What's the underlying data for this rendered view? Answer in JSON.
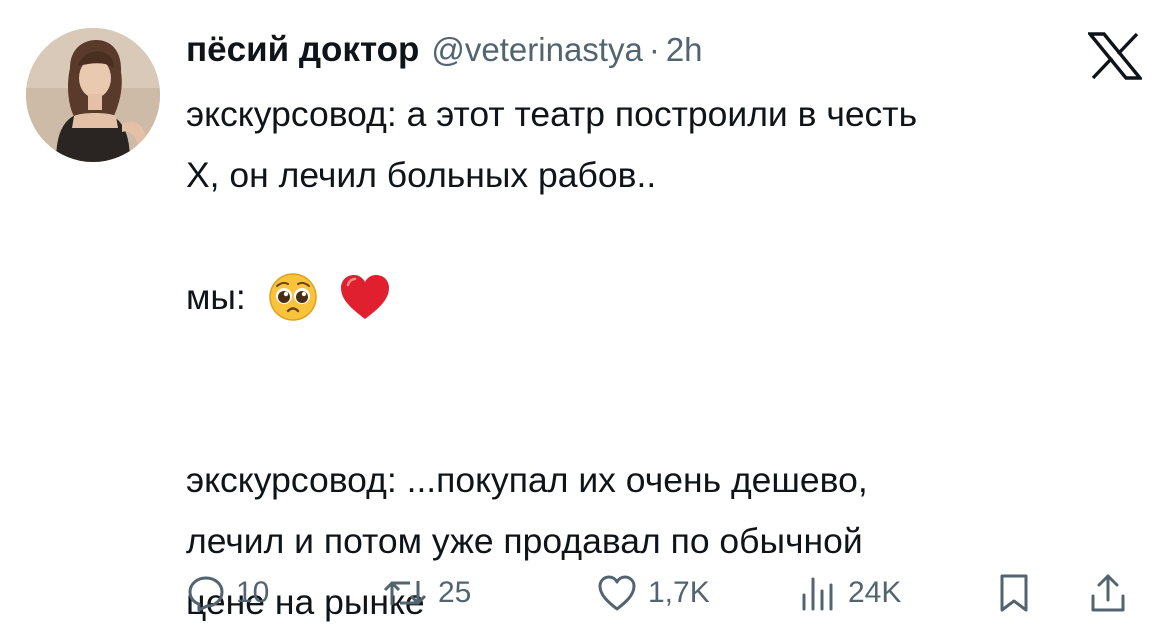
{
  "author": {
    "display_name": "пёсий доктор",
    "handle": "@veterinastya",
    "separator": "·",
    "time": "2h"
  },
  "platform_logo": "x-logo",
  "tweet": {
    "lines": [
      "экскурсовод: а этот театр построили в честь",
      "Х, он лечил больных рабов..",
      "мы:",
      "экскурсовод: ...покупал их очень дешево,",
      "лечил и потом уже продавал по обычной",
      "цене на рынке"
    ],
    "emojis": [
      "pleading-face-emoji",
      "red-heart-emoji"
    ]
  },
  "actions": {
    "reply": {
      "icon": "reply-icon",
      "count": "10"
    },
    "retweet": {
      "icon": "retweet-icon",
      "count": "25"
    },
    "like": {
      "icon": "heart-icon",
      "count": "1,7K"
    },
    "views": {
      "icon": "views-icon",
      "count": "24K"
    },
    "bookmark": {
      "icon": "bookmark-icon"
    },
    "share": {
      "icon": "share-icon"
    }
  },
  "colors": {
    "text": "#0f1419",
    "secondary": "#536471",
    "heart_emoji": "#e0202e",
    "face_emoji": "#f9c33b"
  }
}
